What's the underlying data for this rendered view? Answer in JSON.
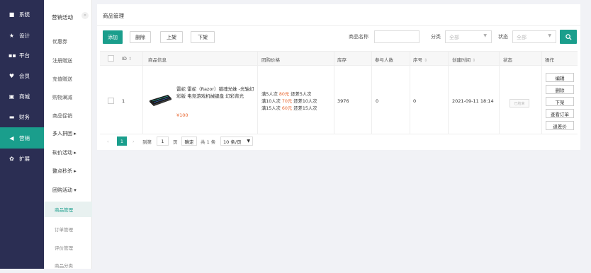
{
  "sidebar": {
    "items": [
      {
        "icon": "monitor-icon",
        "label": "系统"
      },
      {
        "icon": "star-icon",
        "label": "设计"
      },
      {
        "icon": "grid-icon",
        "label": "平台"
      },
      {
        "icon": "heart-icon",
        "label": "会员"
      },
      {
        "icon": "store-icon",
        "label": "商城"
      },
      {
        "icon": "wallet-icon",
        "label": "财务"
      },
      {
        "icon": "megaphone-icon",
        "label": "营销"
      },
      {
        "icon": "puzzle-icon",
        "label": "扩展"
      }
    ]
  },
  "subnav": {
    "title": "营销活动",
    "collapse": "«",
    "items": [
      {
        "label": "优惠券"
      },
      {
        "label": "注册赠送"
      },
      {
        "label": "充值赠送"
      },
      {
        "label": "购物满减"
      },
      {
        "label": "商品促销"
      },
      {
        "label": "多人拼团 ▸"
      },
      {
        "label": "砍价活动 ▸"
      },
      {
        "label": "整点秒杀 ▸"
      },
      {
        "label": "团购活动 ▾"
      },
      {
        "label": "商品管理"
      },
      {
        "label": "订单管理"
      },
      {
        "label": "评价管理"
      },
      {
        "label": "商品分类"
      }
    ]
  },
  "main": {
    "breadcrumb": "商品管理",
    "toolbar": {
      "add": "添加",
      "delete": "删除",
      "shelve": "上架",
      "unshelve": "下架"
    },
    "filters": {
      "name_label": "商品名称",
      "name_value": "",
      "category_label": "分类",
      "category_value": "全部",
      "status_label": "状态",
      "status_value": "全部",
      "search_icon": "search-icon"
    },
    "table": {
      "headers": {
        "id": "ID",
        "product": "商品信息",
        "price": "团购价格",
        "stock": "库存",
        "participants": "参与人数",
        "sort": "序号",
        "created": "创建时间",
        "status": "状态",
        "actions": "操作"
      },
      "sort_glyph": "⇕",
      "rows": [
        {
          "id": "1",
          "name": "雷蛇 雷蛇（Razor）猎魂光蛛 -光轴幻彩版 电竞游戏机械键盘 幻彩背光",
          "price": "¥100",
          "tiers": [
            {
              "a": "满5人次",
              "p": "80元",
              "b": "还差5人次"
            },
            {
              "a": "满10人次",
              "p": "70元",
              "b": "还差10人次"
            },
            {
              "a": "满15人次",
              "p": "60元",
              "b": "还差15人次"
            }
          ],
          "stock": "3976",
          "participants": "0",
          "sort": "0",
          "created": "2021-09-11 18:14",
          "status": "已结束",
          "actions": [
            "编辑",
            "删除",
            "下架",
            "查看订单",
            "退差价"
          ]
        }
      ]
    },
    "pagination": {
      "prev": "‹",
      "page": "1",
      "next": "›",
      "goto_label": "到第",
      "goto_value": "1",
      "page_unit": "页",
      "confirm": "确定",
      "total": "共 1 条",
      "per_page": "10 条/页"
    }
  }
}
